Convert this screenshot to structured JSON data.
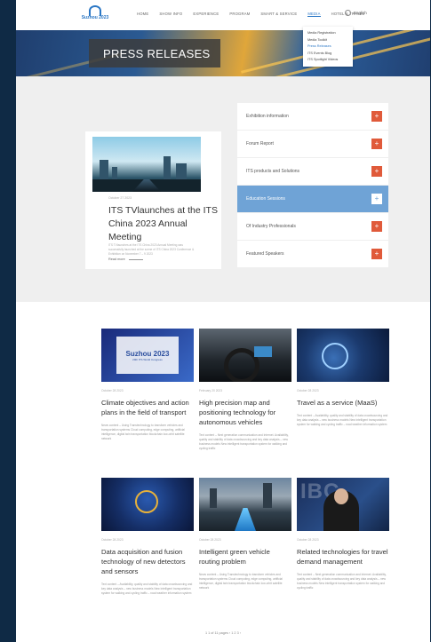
{
  "header": {
    "logo_text": "Suzhou 2023",
    "nav": [
      "HOME",
      "SHOW INFO",
      "EXPERIENCE",
      "PROGRAM",
      "SMART & SERVICE",
      "MEDIA",
      "HOTEL & TRAVEL"
    ],
    "active_nav": 5,
    "language": "English"
  },
  "media_menu": [
    "Media Registration",
    "Media Toolkit",
    "Press Releases",
    "ITS Events Blog",
    "ITS Spotlight Videos"
  ],
  "media_menu_selected": 2,
  "banner": {
    "title": "PRESS RELEASES"
  },
  "featured": {
    "date": "October 27 2023",
    "headline": "ITS TVlaunches at the ITS China 2023 Annual Meeting",
    "description": "ITS TVlaunches at the ITS China 2023 Annual Meeting was successfully launched at the scene of ITS China 2023 Conference & Exhibition on November 7 – 9 2023",
    "read_more": "Read more"
  },
  "categories": [
    {
      "label": "Exhibition information"
    },
    {
      "label": "Forum Report"
    },
    {
      "label": "ITS products and Solutions"
    },
    {
      "label": "Education Sessions"
    },
    {
      "label": "Of Industry Professionals"
    },
    {
      "label": "Featured Speakers"
    }
  ],
  "active_category": 3,
  "news": [
    {
      "date": "October 28 2023",
      "title": "Climate objectives and action plans in the field of transport",
      "text": "News content – Using Transtechnology to transform vehicles and transportation systems Cloud computing, edge computing, artificial intelligence, digital twin transportation blockchain low-orbit satellite network"
    },
    {
      "date": "February 20 2023",
      "title": "High precision map and positioning technology for autonomous vehicles",
      "text": "Text content – Next generation communication and Internet. Availability, quality and stability of data crowdsourcing and key data analysis – new business models New intelligent transportation system for walking and cycling traffic"
    },
    {
      "date": "October 28 2023",
      "title": "Travel as a service (MaaS)",
      "text": "Text content – Availability, quality and stability of data crowdsourcing and key data analysis – new business models New intelligent transportation system for walking and cycling traffic – road weather information system"
    },
    {
      "date": "October 28 2023",
      "title": "Data acquisition and fusion technology of new detectors and sensors",
      "text": "Text content – Availability, quality and stability of data crowdsourcing and key data analysis – new business models New intelligent transportation system for walking and cycling traffic – road weather information system"
    },
    {
      "date": "October 28 2023",
      "title": "Intelligent green vehicle routing problem",
      "text": "News content – Using Transtechnology to transform vehicles and transportation systems Cloud computing, edge computing, artificial intelligence, digital twin transportation blockchain low-orbit satellite network"
    },
    {
      "date": "October 28 2023",
      "title": "Related technologies for travel demand management",
      "text": "Text content – Next generation communication and Internet. Availability, quality and stability of data crowdsourcing and key data analysis – new business models New intelligent transportation system for walking and cycling traffic"
    }
  ],
  "news_image_labels": {
    "suzhou_big": "Suzhou 2023",
    "suzhou_small": "29th ITS World Congress",
    "ibc": "IBC"
  },
  "pagination": "1  1 of 11 pages  ‹  1  2  3  ›",
  "colors": {
    "accent": "#e05a3a",
    "active_category": "#6fa3d6",
    "nav_active": "#2b77c5",
    "page_bg": "#0f2a45"
  }
}
